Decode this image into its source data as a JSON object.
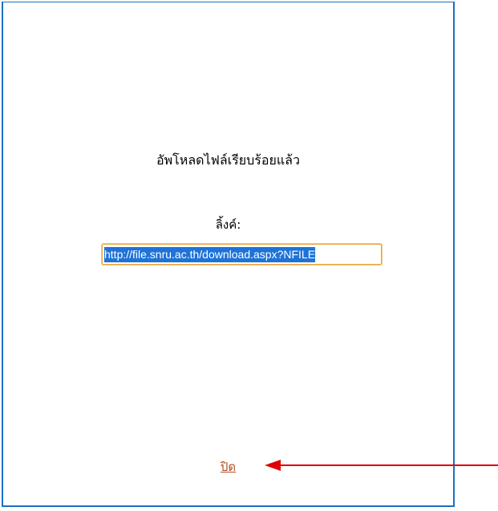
{
  "dialog": {
    "message": "อัพโหลดไฟล์เรียบร้อยแล้ว",
    "link_label": "ลิ้งค์:",
    "link_value": "http://file.snru.ac.th/download.aspx?NFILE",
    "close_label": "ปิด"
  },
  "colors": {
    "border": "#1a6fc4",
    "link": "#b24e1f",
    "arrow": "#e00000",
    "selection": "#1e73d8"
  },
  "annotation": {
    "arrow_icon": "left-arrow-icon"
  }
}
